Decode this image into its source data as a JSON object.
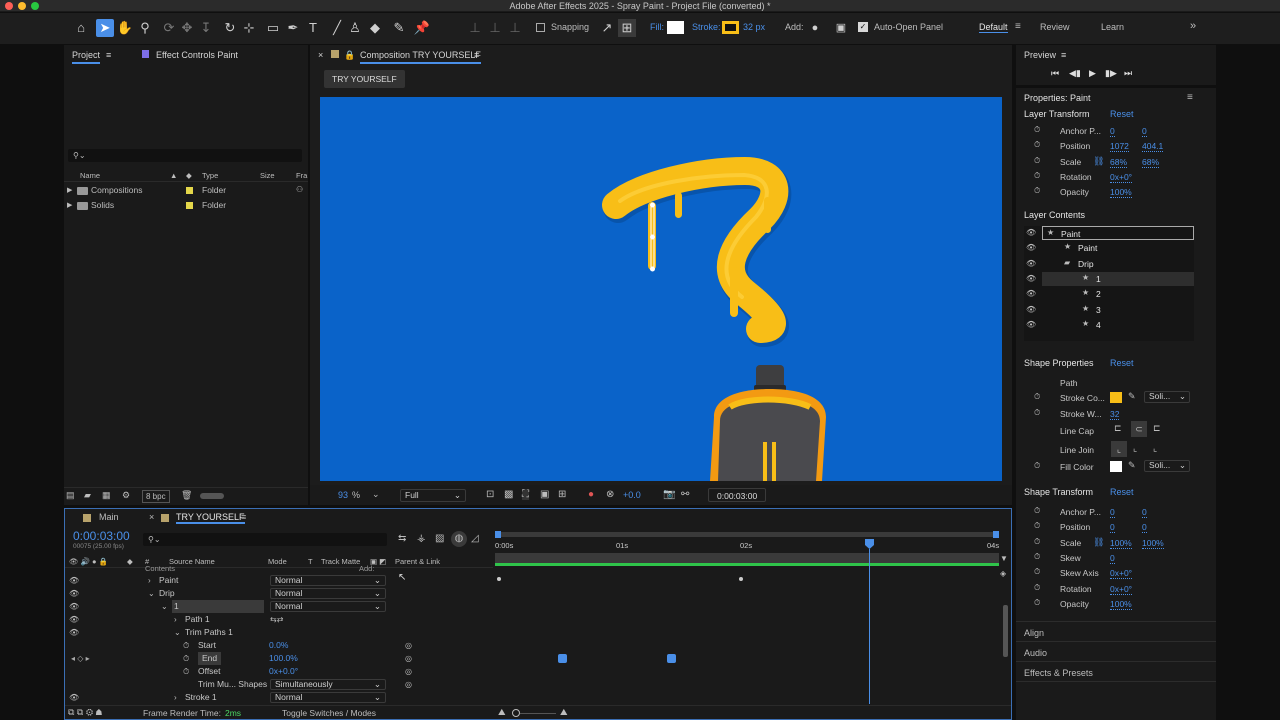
{
  "window": {
    "title": "Adobe After Effects 2025 - Spray Paint - Project File (converted) *"
  },
  "toolbar": {
    "snapping": "Snapping",
    "fill": "Fill:",
    "stroke": "Stroke:",
    "stroke_px": "32 px",
    "add": "Add:",
    "auto_open": "Auto-Open Panel",
    "workspaces": [
      "Default",
      "Review",
      "Learn"
    ]
  },
  "project": {
    "tab": "Project",
    "effect_tab": "Effect Controls Paint",
    "search_placeholder": "⚲⌄",
    "cols": [
      "Name",
      "Type",
      "Size",
      "Fra"
    ],
    "items": [
      {
        "name": "Compositions",
        "type": "Folder"
      },
      {
        "name": "Solids",
        "type": "Folder"
      }
    ],
    "bpc": "8 bpc"
  },
  "comp": {
    "tab": "Composition TRY YOURSELF",
    "breadcrumb": "TRY YOURSELF",
    "zoom": "93",
    "zoom_unit": "%",
    "quality": "Full",
    "exposure": "+0.0",
    "timecode": "0:00:03:00"
  },
  "preview": {
    "title": "Preview"
  },
  "properties": {
    "title": "Properties: Paint",
    "layer_transform": {
      "title": "Layer Transform",
      "reset": "Reset",
      "rows": [
        {
          "label": "Anchor P...",
          "v1": "0",
          "v2": "0"
        },
        {
          "label": "Position",
          "v1": "1072",
          "v2": "404.1"
        },
        {
          "label": "Scale",
          "v1": "68%",
          "v2": "68%"
        },
        {
          "label": "Rotation",
          "v1": "0x+0°",
          "v2": ""
        },
        {
          "label": "Opacity",
          "v1": "100%",
          "v2": ""
        }
      ]
    },
    "layer_contents": {
      "title": "Layer Contents",
      "items": [
        {
          "label": "Paint",
          "indent": 0
        },
        {
          "label": "Paint",
          "indent": 1
        },
        {
          "label": "Drip",
          "indent": 1
        },
        {
          "label": "1",
          "indent": 2
        },
        {
          "label": "2",
          "indent": 2
        },
        {
          "label": "3",
          "indent": 2
        },
        {
          "label": "4",
          "indent": 2
        }
      ]
    },
    "shape_props": {
      "title": "Shape Properties",
      "reset": "Reset",
      "path": "Path",
      "stroke_color": "Stroke Co...",
      "stroke_color_mode": "Soli...",
      "stroke_width": "Stroke W...",
      "stroke_width_val": "32",
      "line_cap": "Line Cap",
      "line_join": "Line Join",
      "fill_color": "Fill Color",
      "fill_mode": "Soli..."
    },
    "shape_transform": {
      "title": "Shape Transform",
      "reset": "Reset",
      "rows": [
        {
          "label": "Anchor P...",
          "v1": "0",
          "v2": "0"
        },
        {
          "label": "Position",
          "v1": "0",
          "v2": "0"
        },
        {
          "label": "Scale",
          "v1": "100%",
          "v2": "100%"
        },
        {
          "label": "Skew",
          "v1": "0",
          "v2": ""
        },
        {
          "label": "Skew Axis",
          "v1": "0x+0°",
          "v2": ""
        },
        {
          "label": "Rotation",
          "v1": "0x+0°",
          "v2": ""
        },
        {
          "label": "Opacity",
          "v1": "100%",
          "v2": ""
        }
      ]
    },
    "collapsed": [
      "Align",
      "Audio",
      "Effects & Presets"
    ]
  },
  "timeline": {
    "tabs": [
      "Main",
      "TRY YOURSELF"
    ],
    "timecode": "0:00:03:00",
    "fps": "00075 (25.00 fps)",
    "cols": {
      "source": "Source Name",
      "mode": "Mode",
      "t": "T",
      "track_matte": "Track Matte",
      "parent": "Parent & Link"
    },
    "contents": "Contents",
    "add": "Add:",
    "rows": [
      {
        "name": "Paint",
        "mode": "Normal",
        "indent": 1,
        "twirl": "›"
      },
      {
        "name": "Drip",
        "mode": "Normal",
        "indent": 1,
        "twirl": "⌄"
      },
      {
        "name": "1",
        "mode": "Normal",
        "indent": 2,
        "twirl": "⌄"
      },
      {
        "name": "Path 1",
        "mode": "",
        "indent": 3,
        "twirl": "›"
      },
      {
        "name": "Trim Paths 1",
        "mode": "",
        "indent": 3,
        "twirl": "⌄"
      },
      {
        "name": "Start",
        "value": "0.0%",
        "indent": 4
      },
      {
        "name": "End",
        "value": "100.0%",
        "indent": 4
      },
      {
        "name": "Offset",
        "value": "0x+0.0°",
        "indent": 4
      },
      {
        "name": "Trim Mu... Shapes",
        "mode": "Simultaneously",
        "indent": 4
      },
      {
        "name": "Stroke 1",
        "mode": "Normal",
        "indent": 3,
        "twirl": "›"
      }
    ],
    "ruler": [
      "0:00s",
      "01s",
      "02s",
      "04s"
    ],
    "render_time_label": "Frame Render Time:",
    "render_time": "2ms",
    "toggle": "Toggle Switches / Modes"
  },
  "colors": {
    "accent": "#4a8fe8",
    "canvas": "#0a63c9",
    "paint": "#f8be17"
  }
}
